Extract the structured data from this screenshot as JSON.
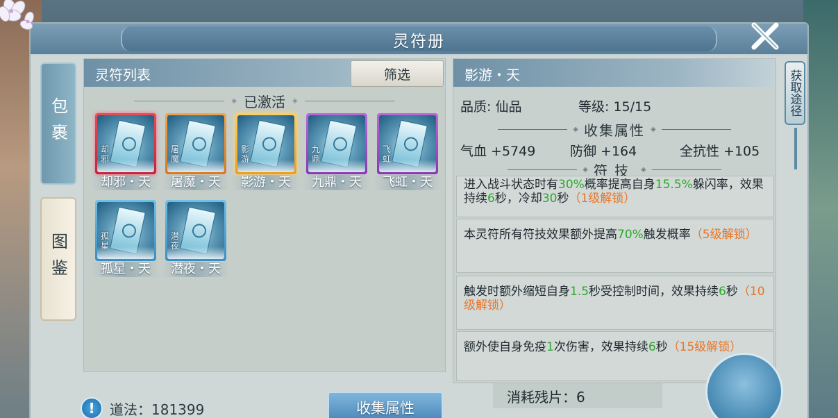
{
  "window": {
    "title": "灵符册"
  },
  "side_tabs": [
    {
      "label": "包裹"
    },
    {
      "label": "图鉴"
    }
  ],
  "list_panel": {
    "title": "灵符列表",
    "filter_label": "筛选",
    "section_label": "已激活",
    "cards": [
      {
        "name": "却邪・天",
        "glyph": "却邪",
        "rarity": "red"
      },
      {
        "name": "屠魔・天",
        "glyph": "屠魔",
        "rarity": "orange"
      },
      {
        "name": "影游・天",
        "glyph": "影游",
        "rarity": "gold"
      },
      {
        "name": "九鼎・天",
        "glyph": "九鼎",
        "rarity": "purple"
      },
      {
        "name": "飞虹・天",
        "glyph": "飞虹",
        "rarity": "purple"
      },
      {
        "name": "孤星・天",
        "glyph": "孤星",
        "rarity": "blue"
      },
      {
        "name": "潜夜・天",
        "glyph": "潜夜",
        "rarity": "blue"
      }
    ]
  },
  "detail_panel": {
    "title": "影游・天",
    "quality": "品质: 仙品",
    "level": "等级: 15/15",
    "collect_section": "收集属性",
    "stats": {
      "hp": "气血 +5749",
      "defense": "防御 +164",
      "resist": "全抗性 +105"
    },
    "skill_section": "符技",
    "skills": [
      {
        "a": "进入战斗状态时有",
        "b": "30%",
        "c": "概率提高自身",
        "d": "15.5%",
        "e": "躲闪率，效果持续",
        "f": "6",
        "g": "秒，冷却",
        "h": "30",
        "i": "秒",
        "unlock": "（1级解锁）"
      },
      {
        "a": "本灵符所有符技效果额外提高",
        "b": "70%",
        "c": "触发概率",
        "unlock": "（5级解锁）"
      },
      {
        "a": "触发时额外缩短自身",
        "b": "1.5",
        "c": "秒受控制时间，效果持续",
        "d": "6",
        "e": "秒",
        "unlock": "（10级解锁）"
      },
      {
        "a": "额外使自身免疫",
        "b": "1",
        "c": "次伤害，效果持续",
        "d": "6",
        "e": "秒",
        "unlock": "（15级解锁）"
      }
    ],
    "get_path": "获取途径",
    "consume": "消耗残片：6"
  },
  "footer": {
    "daofa": "道法：181399",
    "collect_button": "收集属性"
  },
  "colors": {
    "accent_green": "#2ba82b",
    "accent_orange": "#e8752a",
    "header_blue": "#6e90a6"
  }
}
